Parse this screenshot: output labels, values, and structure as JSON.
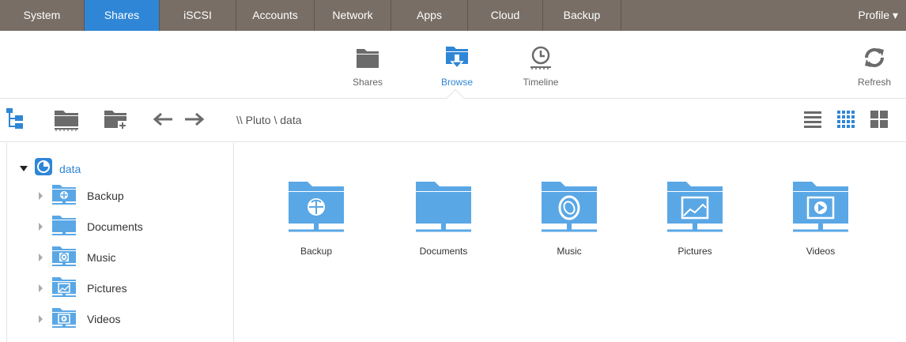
{
  "topnav": {
    "tabs": [
      {
        "label": "System"
      },
      {
        "label": "Shares"
      },
      {
        "label": "iSCSI"
      },
      {
        "label": "Accounts"
      },
      {
        "label": "Network"
      },
      {
        "label": "Apps"
      },
      {
        "label": "Cloud"
      },
      {
        "label": "Backup"
      }
    ],
    "active_tab": "Shares",
    "profile_label": "Profile ▾"
  },
  "subbar": {
    "items": [
      {
        "label": "Shares",
        "icon": "folder-icon"
      },
      {
        "label": "Browse",
        "icon": "folder-download-icon"
      },
      {
        "label": "Timeline",
        "icon": "clock-icon"
      }
    ],
    "active": "Browse",
    "refresh_label": "Refresh"
  },
  "pathbar": {
    "path": "\\\\ Pluto \\ data"
  },
  "tree": {
    "root_label": "data",
    "items": [
      {
        "label": "Backup",
        "icon": "backup-icon"
      },
      {
        "label": "Documents",
        "icon": "documents-icon"
      },
      {
        "label": "Music",
        "icon": "music-icon"
      },
      {
        "label": "Pictures",
        "icon": "pictures-icon"
      },
      {
        "label": "Videos",
        "icon": "videos-icon"
      }
    ]
  },
  "main": {
    "folders": [
      {
        "label": "Backup",
        "icon": "backup-icon"
      },
      {
        "label": "Documents",
        "icon": "documents-icon"
      },
      {
        "label": "Music",
        "icon": "music-icon"
      },
      {
        "label": "Pictures",
        "icon": "pictures-icon"
      },
      {
        "label": "Videos",
        "icon": "videos-icon"
      }
    ]
  },
  "colors": {
    "nav_bg": "#786e66",
    "accent": "#2f86d6",
    "folder_blue": "#5aa7e6",
    "icon_gray": "#6b6b6b"
  }
}
